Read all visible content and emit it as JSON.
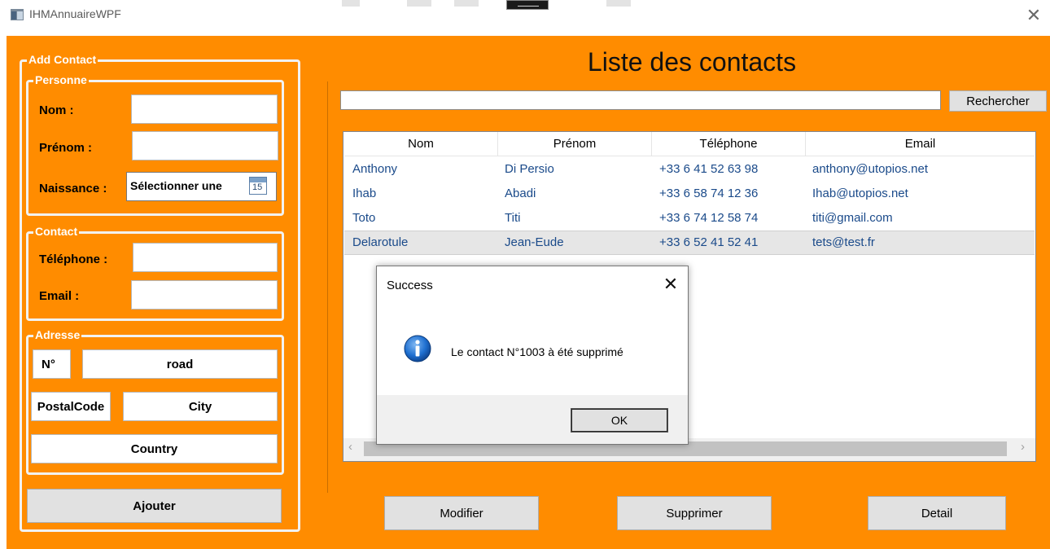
{
  "window": {
    "title": "IHMAnnuaireWPF",
    "close_glyph": "✕"
  },
  "form": {
    "add_contact_title": "Add Contact",
    "personne": {
      "title": "Personne",
      "nom_label": "Nom :",
      "prenom_label": "Prénom :",
      "naissance_label": "Naissance :",
      "date_placeholder": "Sélectionner une",
      "calendar_day": "15"
    },
    "contact": {
      "title": "Contact",
      "telephone_label": "Téléphone :",
      "email_label": "Email :"
    },
    "adresse": {
      "title": "Adresse",
      "numero": "N°",
      "road": "road",
      "postal_code": "PostalCode",
      "city": "City",
      "country": "Country"
    },
    "ajouter_label": "Ajouter"
  },
  "list": {
    "title": "Liste des contacts",
    "search_value": "",
    "search_button": "Rechercher",
    "columns": [
      "Nom",
      "Prénom",
      "Téléphone",
      "Email"
    ],
    "rows": [
      {
        "nom": "Anthony",
        "prenom": "Di Persio",
        "telephone": "+33 6 41 52 63 98",
        "email": "anthony@utopios.net"
      },
      {
        "nom": "Ihab",
        "prenom": "Abadi",
        "telephone": "+33 6 58 74 12 36",
        "email": "Ihab@utopios.net"
      },
      {
        "nom": "Toto",
        "prenom": "Titi",
        "telephone": "+33 6 74 12 58 74",
        "email": "titi@gmail.com"
      },
      {
        "nom": "Delarotule",
        "prenom": "Jean-Eude",
        "telephone": "+33 6 52 41 52 41",
        "email": "tets@test.fr"
      }
    ],
    "selected_row": 3,
    "scroll_left": "‹",
    "scroll_right": "›"
  },
  "actions": {
    "modifier": "Modifier",
    "supprimer": "Supprimer",
    "detail": "Detail"
  },
  "dialog": {
    "title": "Success",
    "close_glyph": "✕",
    "message": "Le contact N°1003 à été supprimé",
    "icon": "info-icon",
    "ok_label": "OK"
  },
  "colors": {
    "background": "#ff8c00",
    "link_text": "#1a4a8a",
    "info_icon": "#1e6fd0"
  }
}
